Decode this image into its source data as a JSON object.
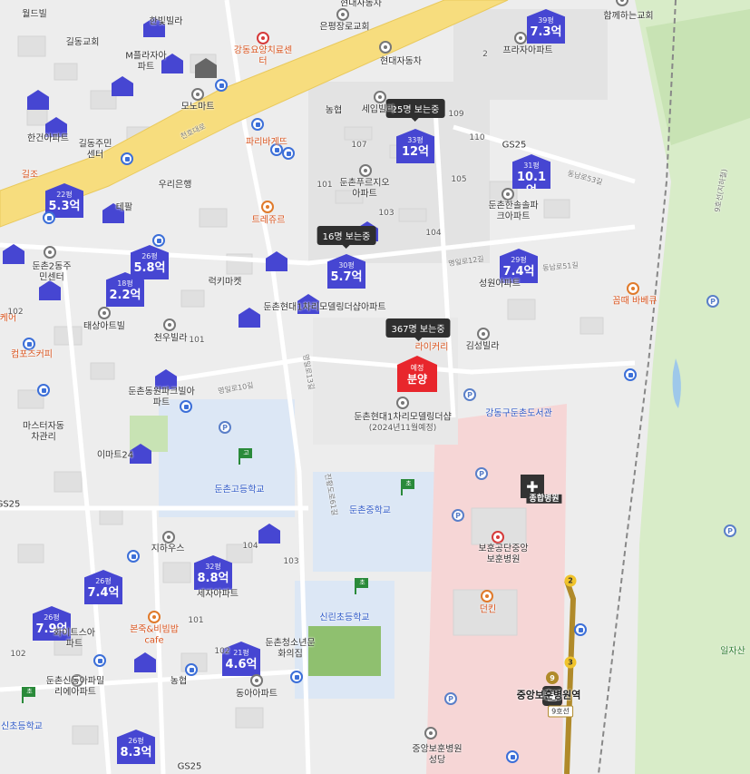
{
  "map": {
    "colors": {
      "marker": "#4646d2",
      "hot_marker": "#e8262c",
      "bubble": "#2f2f2f",
      "main_road": "#f7dd7e",
      "park": "#d8ecc8",
      "hospital_zone": "#f6d6d6",
      "school_zone": "#dce7f5",
      "subway_line9": "#b08a2a"
    },
    "price_markers": [
      {
        "id": "m39",
        "area": "39평",
        "price": "7.3억"
      },
      {
        "id": "m33",
        "area": "33평",
        "price": "12억"
      },
      {
        "id": "m31",
        "area": "31평",
        "price": "10.1억"
      },
      {
        "id": "m22",
        "area": "22평",
        "price": "5.3억"
      },
      {
        "id": "m26a",
        "area": "26평",
        "price": "5.8억"
      },
      {
        "id": "m18",
        "area": "18평",
        "price": "2.2억"
      },
      {
        "id": "m30",
        "area": "30평",
        "price": "5.7억"
      },
      {
        "id": "m29",
        "area": "29평",
        "price": "7.4억"
      },
      {
        "id": "m32",
        "area": "32평",
        "price": "8.8억"
      },
      {
        "id": "m26b",
        "area": "26평",
        "price": "7.4억"
      },
      {
        "id": "m26c",
        "area": "26평",
        "price": "7.9억"
      },
      {
        "id": "m21",
        "area": "21평",
        "price": "4.6억"
      },
      {
        "id": "m26d",
        "area": "26평",
        "price": "8.3억"
      }
    ],
    "viewer_bubbles": [
      {
        "id": "b1",
        "text": "25명 보는중"
      },
      {
        "id": "b2",
        "text": "16명 보는중"
      },
      {
        "id": "b3",
        "text": "367명 보는중"
      }
    ],
    "hot_marker": {
      "line1": "예정",
      "line2": "분양"
    },
    "project_label": {
      "name": "둔촌현대1차리모델링더샵",
      "schedule": "(2024년11월예정)"
    },
    "hospital_badge": "종합병원",
    "station_name": "중앙보훈병원역",
    "line_label": "9호선",
    "exit_numbers": [
      "2",
      "3"
    ],
    "line_badge": "9",
    "road_labels": [
      "천호대로",
      "동남로53길",
      "명일로12길",
      "동남로51길",
      "명일로10길",
      "진황도로61길",
      "9호선(지하철)",
      "명일로13길"
    ],
    "flag_labels": {
      "high": "고",
      "mid": "초",
      "elem": "초"
    },
    "labels": {
      "l01": "월드빌",
      "l02": "한빛빌라",
      "l03": "현대자동차",
      "l04": "함께하는교회",
      "l05": "길동교회",
      "l06": "M플라자아파트",
      "l07": "강동요양치료센터",
      "l08": "은평장로교회",
      "l09": "프라자아파트",
      "l10": "현대자동차",
      "l11": "모노마트",
      "l12": "농협",
      "l13": "세입빌라",
      "l14": "한건아파트",
      "l15": "길동주민센터",
      "l16": "파리바게뜨",
      "l17": "GS25",
      "l18": "길조",
      "l19": "우리은행",
      "l20": "둔촌푸르지오아파트",
      "l21": "둔촌한솔솔파크아파트",
      "l22": "트레쥬르",
      "l23": "테팔",
      "l24": "둔촌2동주민센터",
      "l25": "럭키마켓",
      "l26": "둔촌현대1차리모델링더샵아파트",
      "l27": "성원아파트",
      "l28": "꼼때 바베큐",
      "l29": "태상아트빌",
      "l30": "천우빌라",
      "l31": "라이커리",
      "l32": "김성빌라",
      "l33": "컴포즈커피",
      "l34": "둔촌동원파크빌아파트",
      "l35": "강동구둔촌도서관",
      "l36": "마스터자동차관리",
      "l37": "이마트24",
      "l38": "둔촌고등학교",
      "l39": "둔촌중학교",
      "l40": "보훈공단중앙보훈병원",
      "l41": "지하우스",
      "l42": "세자아파트",
      "l43": "던킨",
      "l44": "신린초등학교",
      "l45": "본죽&비빔밥cafe",
      "l46": "화이트스아파트",
      "l47": "둔촌청소년문화의집",
      "l48": "둔촌신동아파밀리에아파트",
      "l49": "동아아파트",
      "l50": "농협",
      "l51": "신초등학교",
      "l52": "중앙보훈병원성당",
      "l53": "GS25",
      "l54": "일자산",
      "l55": "케어",
      "l56": "GS25"
    },
    "building_numbers": [
      "109",
      "110",
      "107",
      "105",
      "101",
      "103",
      "104",
      "102",
      "101",
      "103",
      "104",
      "102",
      "101",
      "102",
      "2"
    ]
  }
}
